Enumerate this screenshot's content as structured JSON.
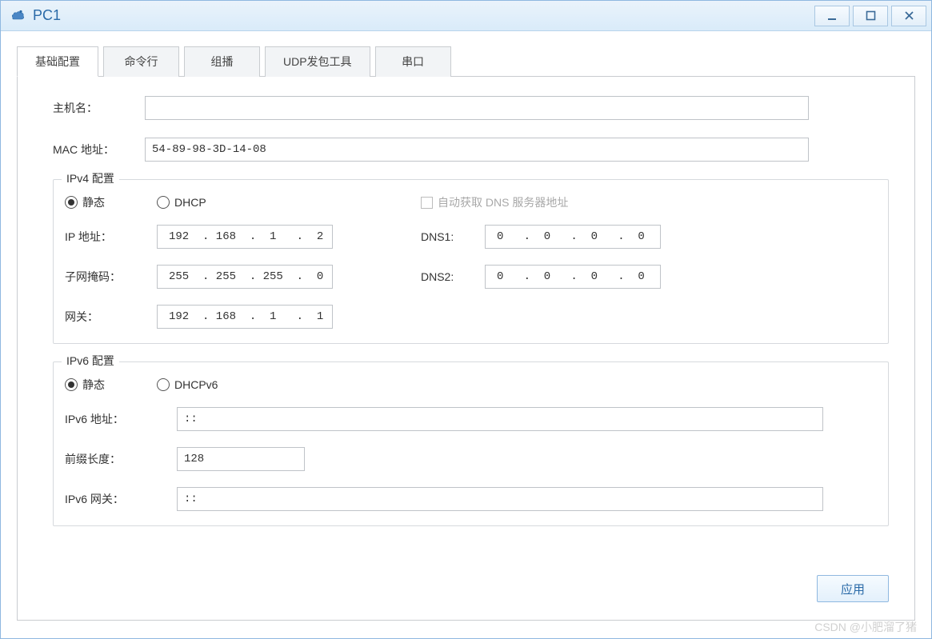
{
  "window": {
    "title": "PC1"
  },
  "tabs": {
    "basic": "基础配置",
    "cmdline": "命令行",
    "multicast": "组播",
    "udptool": "UDP发包工具",
    "serial": "串口"
  },
  "basic": {
    "hostname_label": "主机名：",
    "hostname_value": "",
    "mac_label": "MAC 地址：",
    "mac_value": "54-89-98-3D-14-08"
  },
  "ipv4": {
    "legend": "IPv4 配置",
    "radio_static": "静态",
    "radio_dhcp": "DHCP",
    "auto_dns_label": "自动获取 DNS 服务器地址",
    "ip_label": "IP 地址：",
    "ip_value": "192  . 168  .  1   .  2",
    "mask_label": "子网掩码：",
    "mask_value": "255  . 255  . 255  .  0",
    "gateway_label": "网关：",
    "gateway_value": "192  . 168  .  1   .  1",
    "dns1_label": "DNS1:",
    "dns1_value": "0   .  0   .  0   .  0",
    "dns2_label": "DNS2:",
    "dns2_value": "0   .  0   .  0   .  0"
  },
  "ipv6": {
    "legend": "IPv6 配置",
    "radio_static": "静态",
    "radio_dhcpv6": "DHCPv6",
    "ipv6_addr_label": "IPv6 地址：",
    "ipv6_addr_value": "::",
    "prefix_label": "前缀长度：",
    "prefix_value": "128",
    "ipv6_gw_label": "IPv6 网关：",
    "ipv6_gw_value": "::"
  },
  "actions": {
    "apply": "应用"
  },
  "watermark": "CSDN @小肥溜了猪"
}
